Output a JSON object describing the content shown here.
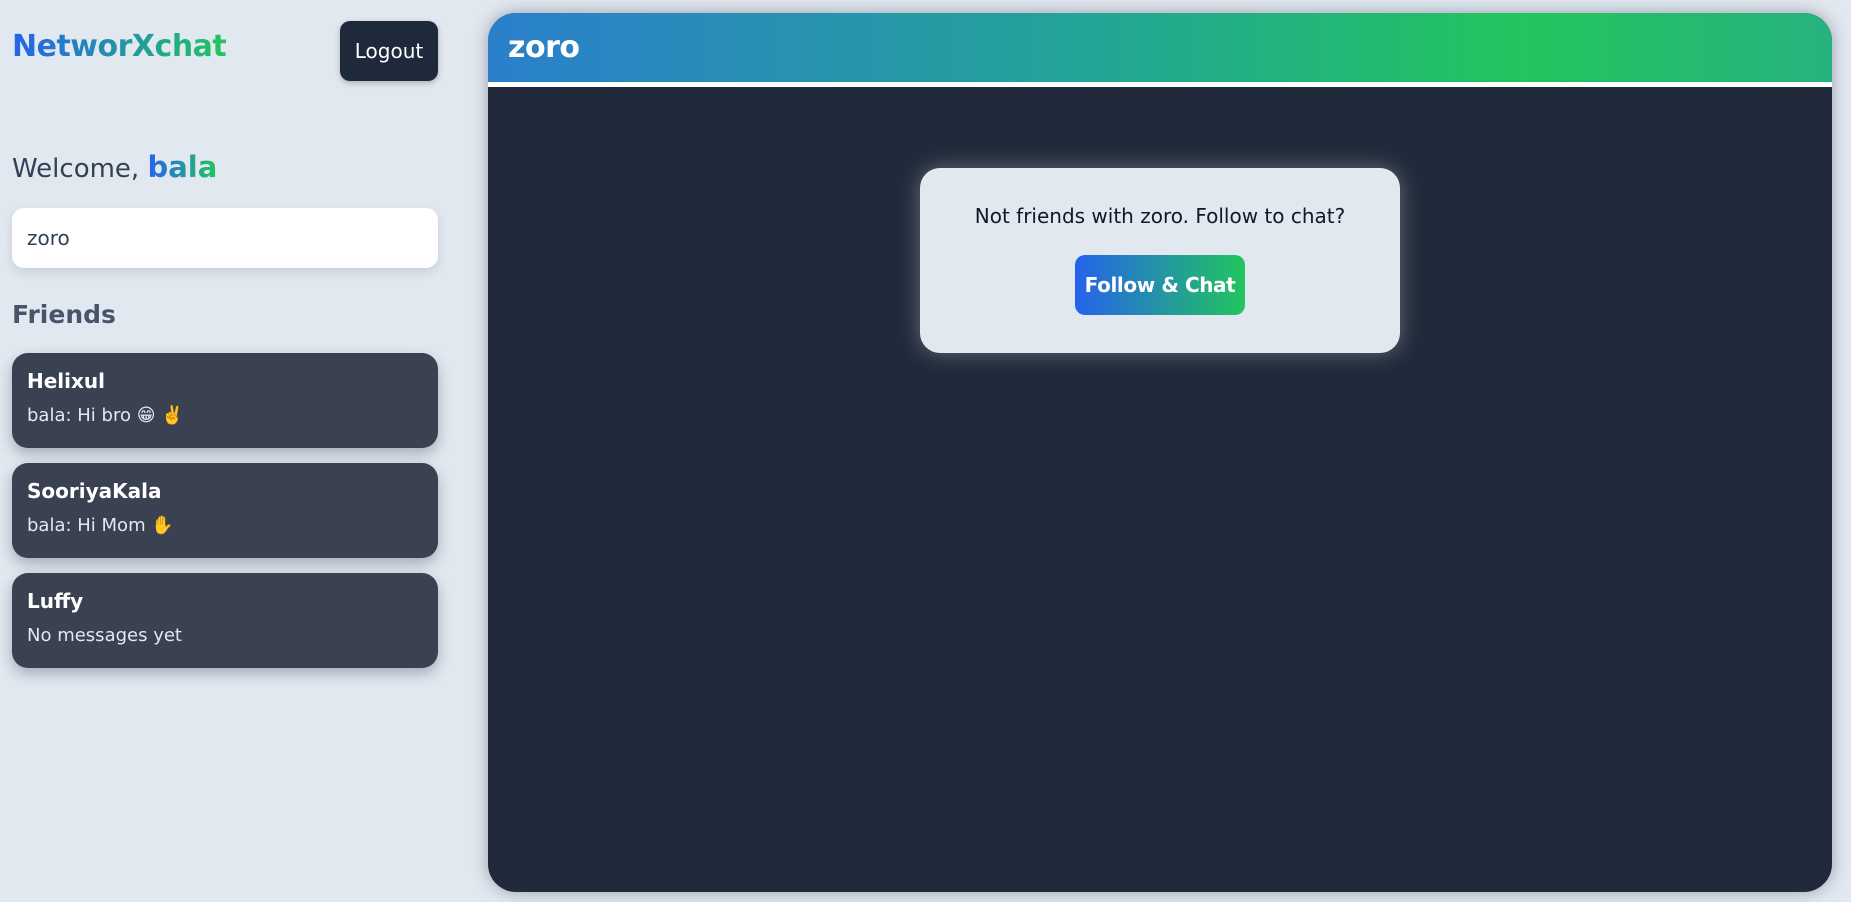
{
  "app": {
    "brand": "NetworXchat",
    "logout_label": "Logout"
  },
  "sidebar": {
    "welcome_prefix": "Welcome, ",
    "username": "bala",
    "search": {
      "value": "zoro",
      "placeholder": ""
    },
    "friends_heading": "Friends",
    "friends": [
      {
        "name": "Helixul",
        "last_message": "bala: Hi bro 😁 ✌️"
      },
      {
        "name": "SooriyaKala",
        "last_message": "bala: Hi Mom ✋"
      },
      {
        "name": "Luffy",
        "last_message": "No messages yet"
      }
    ]
  },
  "chat": {
    "title": "zoro",
    "prompt_text": "Not friends with zoro. Follow to chat?",
    "follow_button": "Follow & Chat"
  },
  "colors": {
    "accent_start": "#2563eb",
    "accent_end": "#22c55e",
    "sidebar_bg": "#e2e8f0",
    "chat_bg": "#212a3a",
    "card_bg": "#3a4252"
  }
}
